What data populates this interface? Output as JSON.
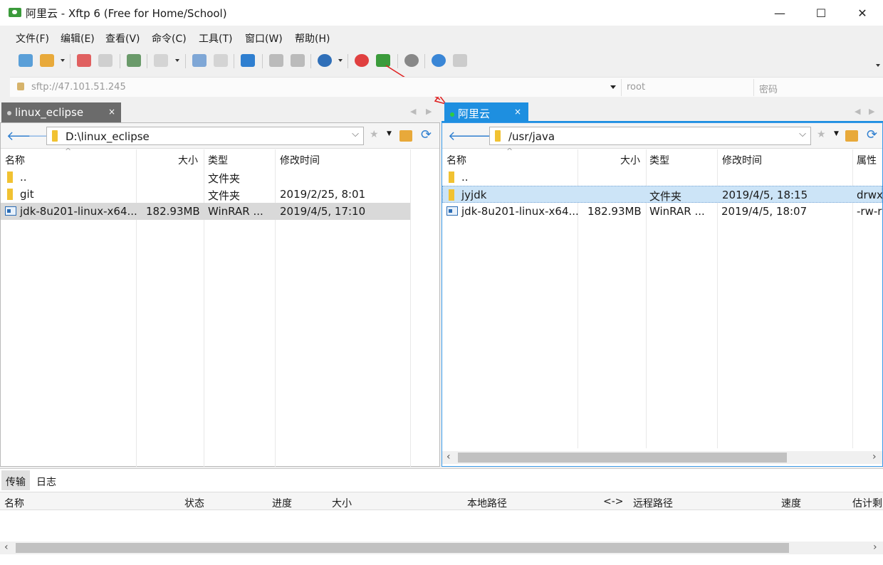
{
  "window": {
    "title": "阿里云 - Xftp 6 (Free for Home/School)",
    "minimize": "—",
    "maximize": "☐",
    "close": "✕"
  },
  "menu": [
    "文件(F)",
    "编辑(E)",
    "查看(V)",
    "命令(C)",
    "工具(T)",
    "窗口(W)",
    "帮助(H)"
  ],
  "address": {
    "url": "sftp://47.101.51.245",
    "user_placeholder": "root",
    "password_placeholder": "密码"
  },
  "left": {
    "tab_label": "linux_eclipse",
    "tab_close": "×",
    "path": "D:\\linux_eclipse",
    "columns": [
      "名称",
      "大小",
      "类型",
      "修改时间"
    ],
    "rows": [
      {
        "name": "..",
        "size": "",
        "type": "文件夹",
        "modified": "",
        "kind": "folder"
      },
      {
        "name": "git",
        "size": "",
        "type": "文件夹",
        "modified": "2019/2/25, 8:01",
        "kind": "folder"
      },
      {
        "name": "jdk-8u201-linux-x64...",
        "size": "182.93MB",
        "type": "WinRAR ...",
        "modified": "2019/4/5, 17:10",
        "kind": "rar"
      }
    ]
  },
  "right": {
    "tab_label": "阿里云",
    "tab_close": "×",
    "path": "/usr/java",
    "columns": [
      "名称",
      "大小",
      "类型",
      "修改时间",
      "属性"
    ],
    "rows": [
      {
        "name": "..",
        "size": "",
        "type": "",
        "modified": "",
        "attr": "",
        "kind": "folder"
      },
      {
        "name": "jyjdk",
        "size": "",
        "type": "文件夹",
        "modified": "2019/4/5, 18:15",
        "attr": "drwx",
        "kind": "folder"
      },
      {
        "name": "jdk-8u201-linux-x64...",
        "size": "182.93MB",
        "type": "WinRAR ...",
        "modified": "2019/4/5, 18:07",
        "attr": "-rw-r",
        "kind": "rar"
      }
    ]
  },
  "transfer": {
    "tabs": [
      "传输",
      "日志"
    ],
    "columns": [
      "名称",
      "状态",
      "进度",
      "大小",
      "本地路径",
      "<->",
      "远程路径",
      "速度",
      "估计剩"
    ]
  },
  "colors": {
    "accent": "#1e8fe0",
    "selected_row": "#cce4f7",
    "arrow_red": "#e02020"
  }
}
